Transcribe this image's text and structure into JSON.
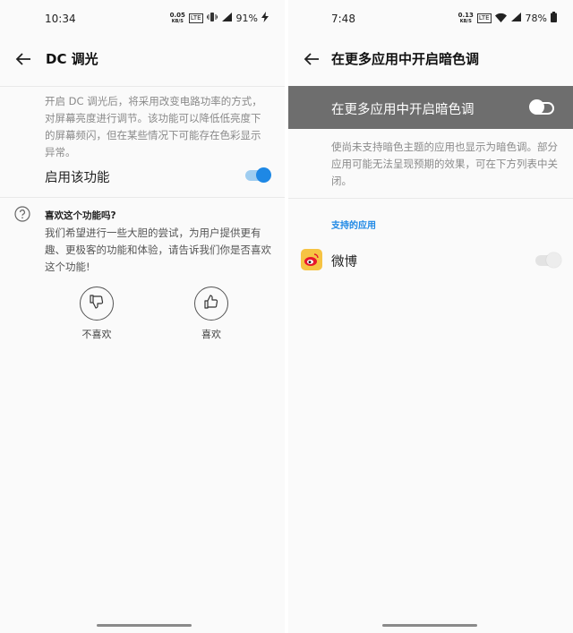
{
  "left": {
    "status": {
      "time": "10:34",
      "speed_top": "0.05",
      "speed_bottom": "KB/S",
      "net_type": "LTE",
      "battery": "91%"
    },
    "title": "DC 调光",
    "description": "开启 DC 调光后，将采用改变电路功率的方式，对屏幕亮度进行调节。该功能可以降低低亮度下的屏幕频闪，但在某些情况下可能存在色彩显示异常。",
    "enable_label": "启用该功能",
    "enable_state": "on",
    "feedback": {
      "question": "喜欢这个功能吗?",
      "body": "我们希望进行一些大胆的尝试，为用户提供更有趣、更极客的功能和体验，请告诉我们你是否喜欢这个功能!",
      "dislike_label": "不喜欢",
      "like_label": "喜欢"
    }
  },
  "right": {
    "status": {
      "time": "7:48",
      "speed_top": "0.13",
      "speed_bottom": "KB/S",
      "net_type": "LTE",
      "battery": "78%"
    },
    "title": "在更多应用中开启暗色调",
    "master_label": "在更多应用中开启暗色调",
    "master_state": "off",
    "description": "使尚未支持暗色主题的应用也显示为暗色调。部分应用可能无法呈现预期的效果，可在下方列表中关闭。",
    "section_title": "支持的应用",
    "apps": [
      {
        "name": "微博",
        "state": "on-disabled"
      }
    ]
  },
  "colors": {
    "accent": "#1e88e5",
    "banner": "#6e6e6e",
    "background": "#fafafa"
  },
  "icons": [
    "back-arrow-icon",
    "help-circle-icon",
    "thumbs-down-icon",
    "thumbs-up-icon",
    "weibo-icon",
    "wifi-icon",
    "signal-icon",
    "battery-icon",
    "vibrate-icon",
    "charging-icon"
  ]
}
